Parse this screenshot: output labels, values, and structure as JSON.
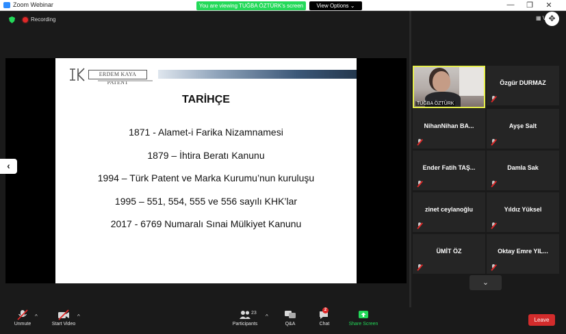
{
  "window": {
    "title": "Zoom Webinar",
    "viewing_banner": "You are viewing TUĞBA ÖZTÜRK's screen",
    "view_options": "View Options ⌄",
    "minimize": "—",
    "restore": "❐",
    "close": "✕"
  },
  "status": {
    "recording_label": "Recording"
  },
  "slide": {
    "logo_text": "ERDEM KAYA PATENT",
    "title": "TARİHÇE",
    "lines": [
      "1871 - Alamet-i Farika Nizamnamesi",
      "1879 – İhtira Beratı Kanunu",
      "1994 – Türk Patent ve Marka Kurumu’nun kuruluşu",
      "1995 – 551, 554, 555 ve 556 sayılı KHK’lar",
      "2017 - 6769 Numaralı Sınai Mülkiyet Kanunu"
    ]
  },
  "panel": {
    "view_label": "View",
    "video_tile_name": "TUĞBA ÖZTÜRK",
    "participants": [
      "Özgür DURMAZ",
      "NihanNihan BA...",
      "Ayşe Salt",
      "Ender Fatih TAŞ...",
      "Damla Sak",
      "zinet ceylanoğlu",
      "Yıldız Yüksel",
      "ÜMİT ÖZ",
      "Oktay Emre YIL..."
    ]
  },
  "toolbar": {
    "unmute": "Unmute",
    "start_video": "Start Video",
    "participants": "Participants",
    "participants_count": "23",
    "qa": "Q&A",
    "chat": "Chat",
    "chat_badge": "2",
    "share_screen": "Share Screen",
    "leave": "Leave"
  },
  "colors": {
    "accent_green": "#23d959",
    "leave_red": "#d32c2c",
    "video_border": "#e6ef4c",
    "background": "#1a1a1a"
  }
}
